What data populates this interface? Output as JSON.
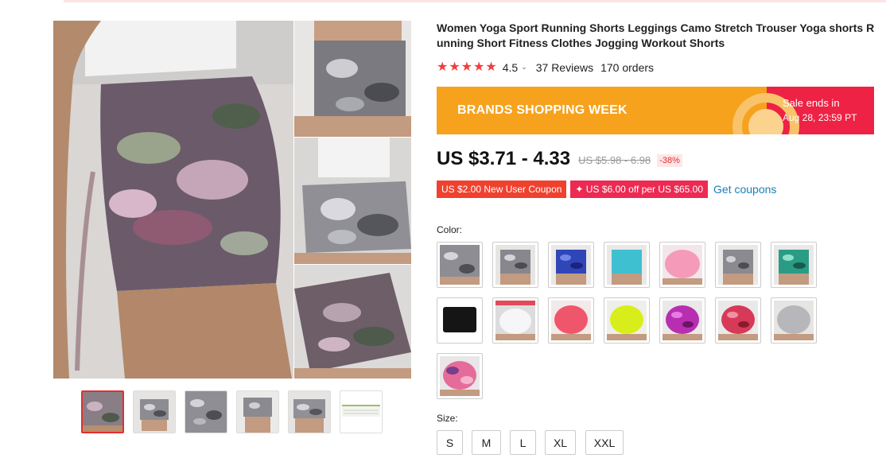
{
  "product": {
    "title": "Women Yoga Sport Running Shorts Leggings Camo Stretch Trouser Yoga shorts Running Short Fitness Clothes Jogging Workout Shorts",
    "rating": "4.5",
    "rating_stars": 5,
    "reviews": "37 Reviews",
    "orders": "170 orders"
  },
  "banner": {
    "title": "BRANDS SHOPPING WEEK",
    "sale_line1": "Sale ends in",
    "sale_line2": "Aug 28, 23:59 PT",
    "colors": {
      "orange": "#f6a21d",
      "red": "#ee2244"
    }
  },
  "price": {
    "current": "US $3.71 - 4.33",
    "original": "US $5.98 - 6.98",
    "discount": "-38%"
  },
  "coupons": {
    "new_user": "US $2.00 New User Coupon",
    "store": "✦ US $6.00 off per US $65.00",
    "get_link": "Get coupons"
  },
  "options": {
    "color_label": "Color:",
    "size_label": "Size:",
    "sizes": [
      "S",
      "M",
      "L",
      "XL",
      "XXL"
    ],
    "color_swatches": [
      {
        "name": "grey camo"
      },
      {
        "name": "grey camo 2"
      },
      {
        "name": "blue camo"
      },
      {
        "name": "light blue"
      },
      {
        "name": "pink"
      },
      {
        "name": "grey camo 3"
      },
      {
        "name": "green camo"
      },
      {
        "name": "black"
      },
      {
        "name": "white"
      },
      {
        "name": "coral"
      },
      {
        "name": "lime"
      },
      {
        "name": "purple camo"
      },
      {
        "name": "red camo"
      },
      {
        "name": "grey"
      },
      {
        "name": "pink tie-dye"
      }
    ]
  },
  "gallery": {
    "thumb_count": 6,
    "active_thumb": 0
  }
}
